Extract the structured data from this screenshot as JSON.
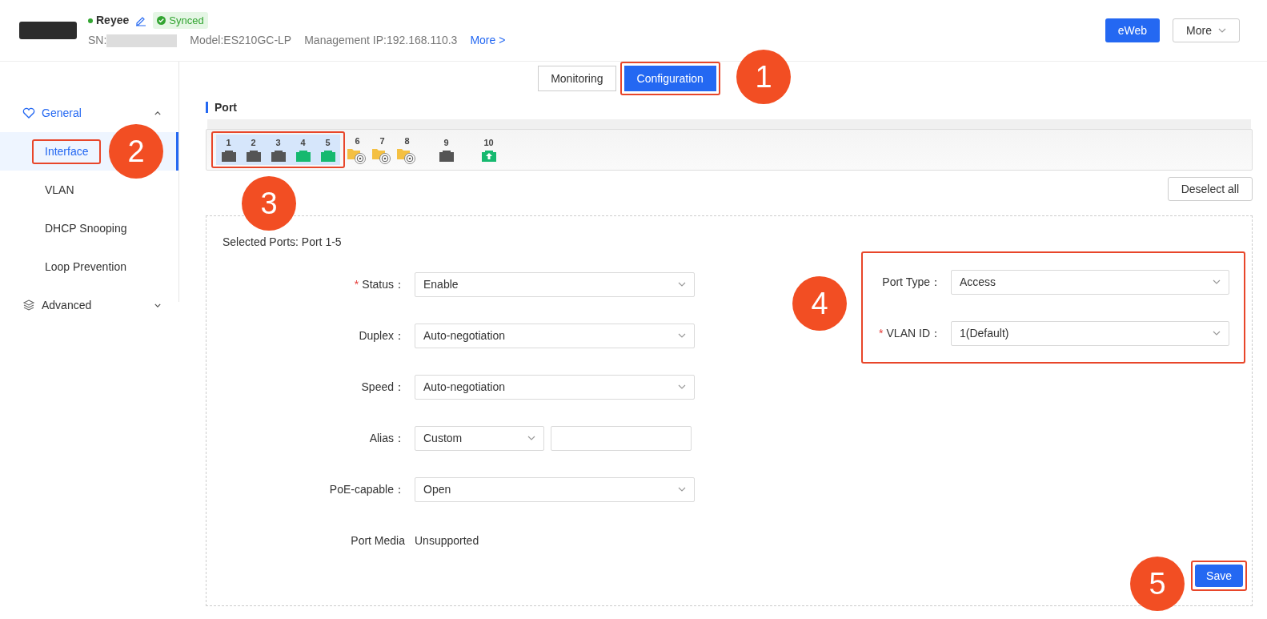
{
  "device": {
    "name": "Reyee",
    "online": true,
    "sync_badge": "Synced",
    "sn_label": "SN:",
    "model": "Model:ES210GC-LP",
    "ip": "Management IP:192.168.110.3",
    "more_link": "More >"
  },
  "header_buttons": [
    {
      "label": "eWeb",
      "kind": "primary"
    },
    {
      "label": "More",
      "kind": "dropdown"
    }
  ],
  "view_tabs": [
    {
      "label": "Monitoring",
      "selected": false,
      "highlighted": false
    },
    {
      "label": "Configuration",
      "selected": true,
      "highlighted": true
    }
  ],
  "sidebar": [
    {
      "label": "General",
      "expanded": true,
      "children": [
        {
          "label": "Interface",
          "selected": true,
          "highlighted": true
        },
        {
          "label": "VLAN",
          "selected": false,
          "highlighted": false
        },
        {
          "label": "DHCP Snooping",
          "selected": false,
          "highlighted": false
        },
        {
          "label": "Loop Prevention",
          "selected": false,
          "highlighted": false
        }
      ]
    },
    {
      "label": "Advanced",
      "expanded": false
    }
  ],
  "section_title": "Port",
  "ports": [
    {
      "label": "1",
      "kind": "copper",
      "link_up": false,
      "selected": true
    },
    {
      "label": "2",
      "kind": "copper",
      "link_up": false,
      "selected": true
    },
    {
      "label": "3",
      "kind": "copper",
      "link_up": false,
      "selected": true
    },
    {
      "label": "4",
      "kind": "copper",
      "link_up": true,
      "selected": true
    },
    {
      "label": "5",
      "kind": "copper",
      "link_up": true,
      "selected": true
    },
    {
      "label": "6",
      "kind": "fiber",
      "link_up": false,
      "selected": false
    },
    {
      "label": "7",
      "kind": "fiber",
      "link_up": false,
      "selected": false
    },
    {
      "label": "8",
      "kind": "fiber",
      "link_up": false,
      "selected": false
    },
    {
      "label": "9",
      "kind": "copper",
      "link_up": false,
      "selected": false
    },
    {
      "label": "10",
      "kind": "uplink",
      "link_up": true,
      "selected": false
    }
  ],
  "highlight_selected_ports": true,
  "deselect_button": "Deselect all",
  "selected_ports_text": "Selected Ports: Port 1-5",
  "left_fields": [
    {
      "label": "Status：",
      "required_mark": "*",
      "kind": "select",
      "value": "Enable"
    },
    {
      "label": "Duplex：",
      "kind": "select",
      "value": "Auto-negotiation"
    },
    {
      "label": "Speed：",
      "kind": "select",
      "value": "Auto-negotiation"
    },
    {
      "label": "Alias：",
      "kind": "select_input",
      "value": "Custom"
    },
    {
      "label": "PoE-capable：",
      "kind": "select",
      "value": "Open"
    },
    {
      "label": "Port Media",
      "kind": "text",
      "value": "Unsupported"
    }
  ],
  "right_fields": {
    "highlighted": true,
    "fields": [
      {
        "label": "Port Type：",
        "kind": "select",
        "value": "Access"
      },
      {
        "label": "VLAN ID：",
        "required_mark": "*",
        "kind": "select",
        "value": "1(Default)"
      }
    ]
  },
  "save_button": {
    "label": "Save",
    "highlighted": true
  },
  "callouts": [
    "1",
    "2",
    "3",
    "4",
    "5"
  ]
}
